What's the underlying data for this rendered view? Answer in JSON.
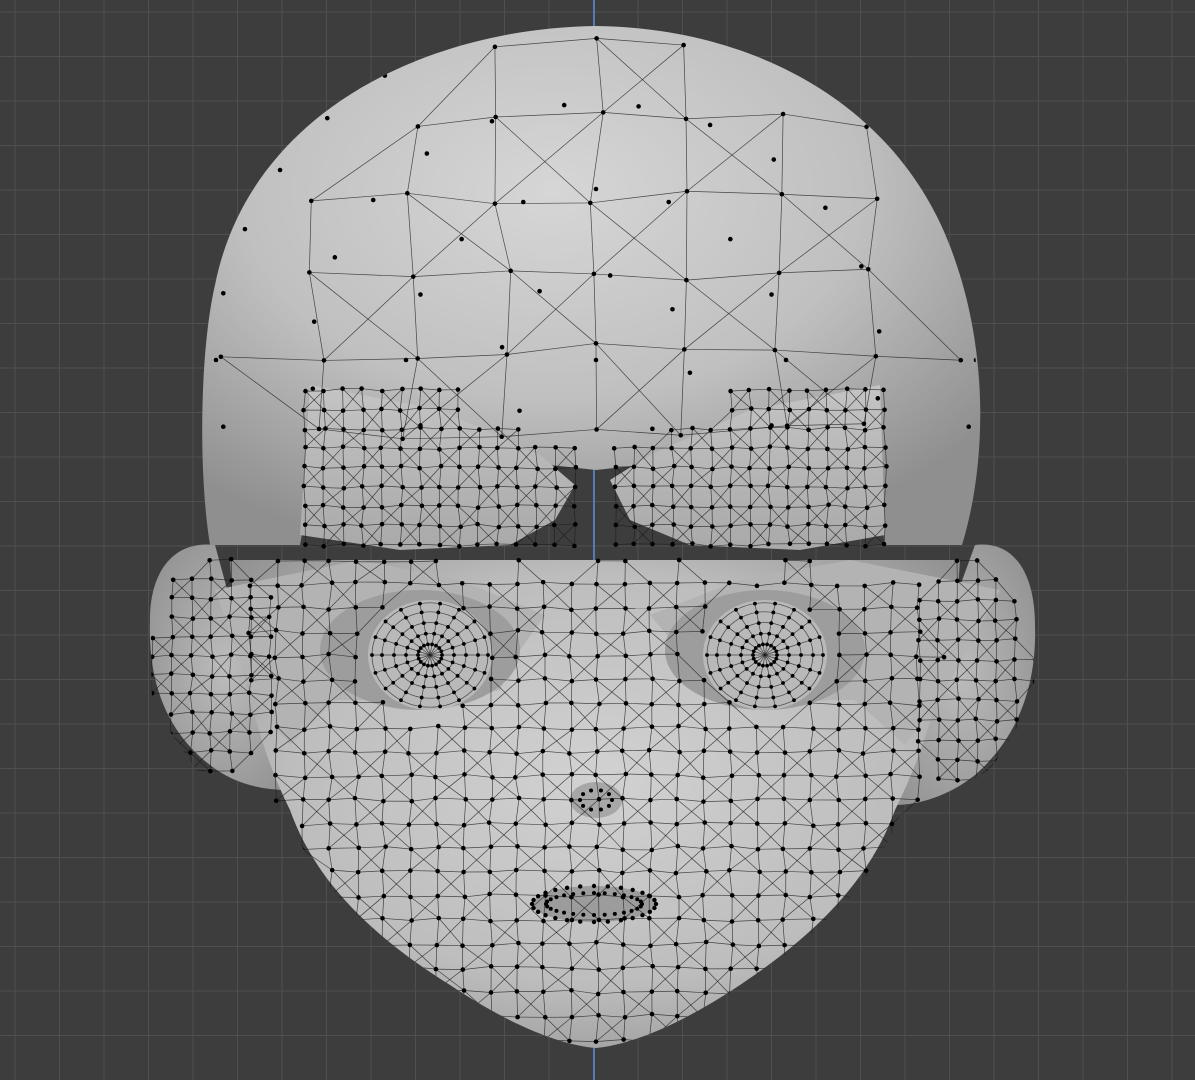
{
  "viewport": {
    "mode": "Edit Mode",
    "view": "front-orthographic",
    "background_color": "#3d3d3d",
    "grid_color": "#4f4f4f",
    "axis_color": "#5b8fd6",
    "mesh_surface_color": "#c9c9c9",
    "wire_color": "#1a1a1a",
    "vertex_color": "#000000",
    "object_icon": "mesh-head-icon"
  }
}
